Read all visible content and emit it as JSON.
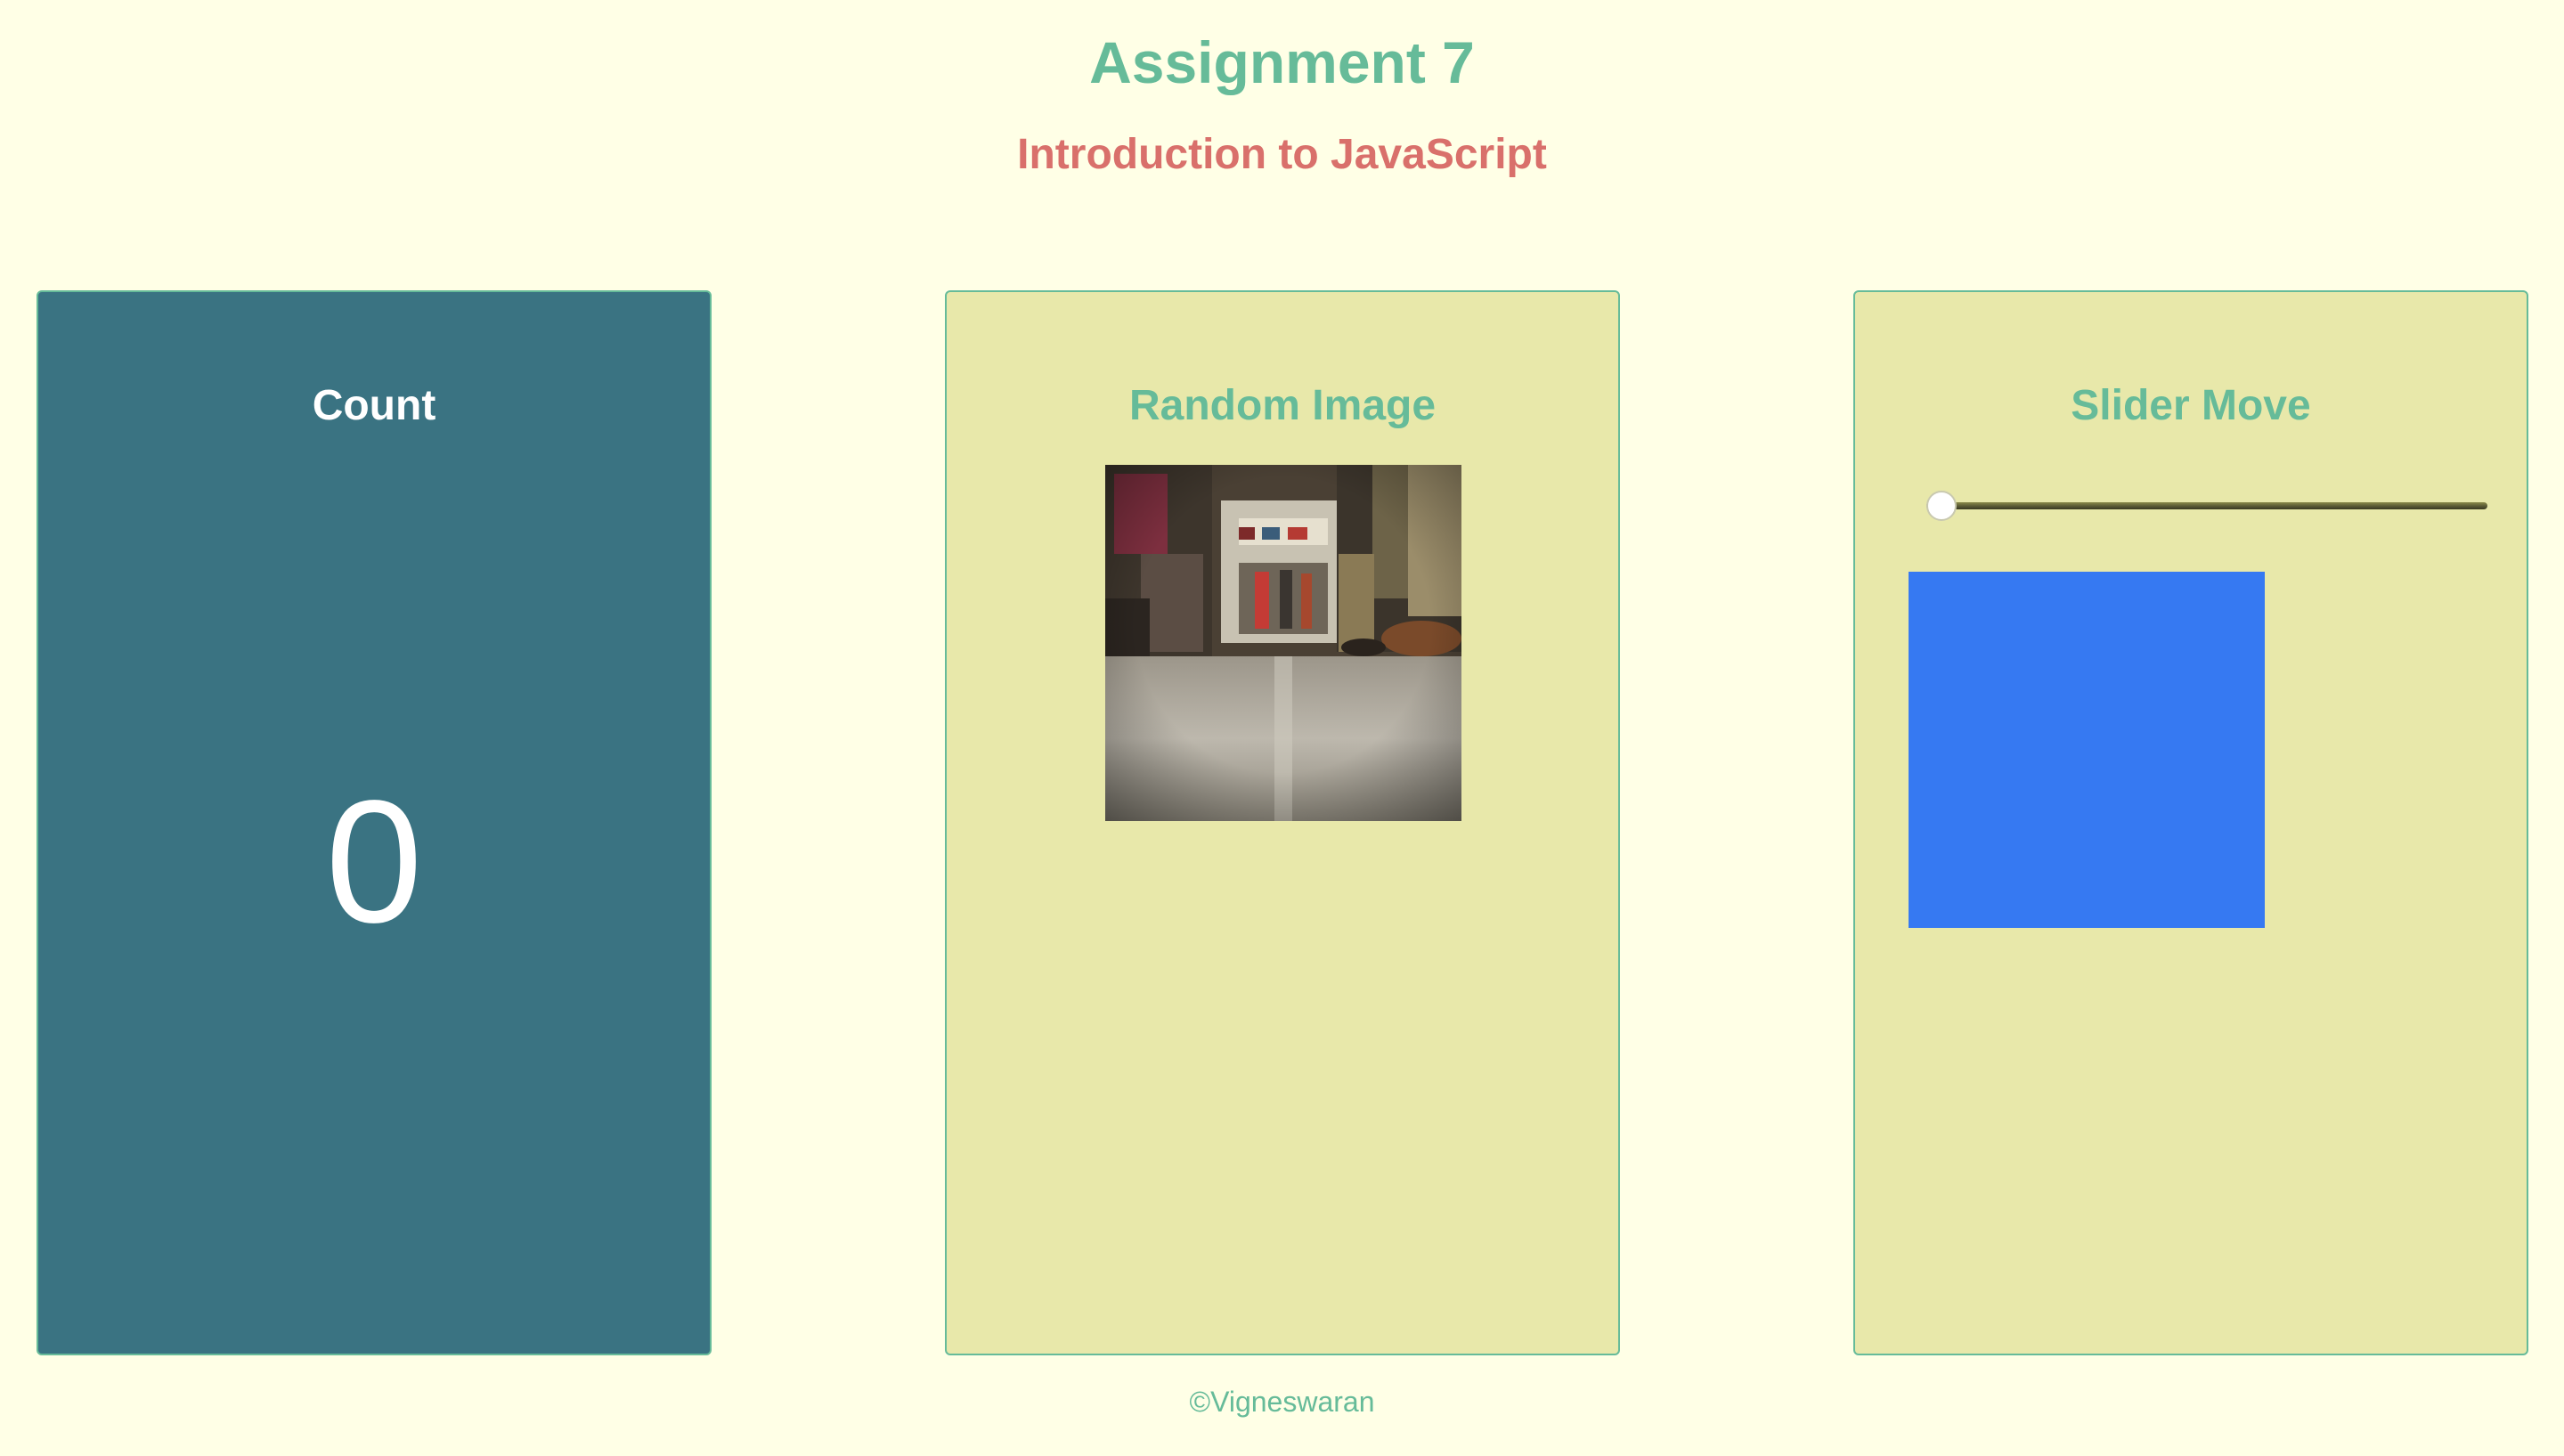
{
  "header": {
    "title": "Assignment 7",
    "subtitle": "Introduction to JavaScript"
  },
  "cards": {
    "count": {
      "title": "Count",
      "value": "0"
    },
    "random_image": {
      "title": "Random Image"
    },
    "slider_move": {
      "title": "Slider Move",
      "slider_value_percent": 0
    }
  },
  "footer": {
    "text": "©Vigneswaran"
  },
  "colors": {
    "page_background": "#ffffe6",
    "title": "#66bb99",
    "subtitle": "#d9706b",
    "count_card": "#3a7382",
    "light_card": "#e8e8aa",
    "card_border": "#66bb99",
    "card_text_light": "#ffffff",
    "box": "#3679f2"
  }
}
